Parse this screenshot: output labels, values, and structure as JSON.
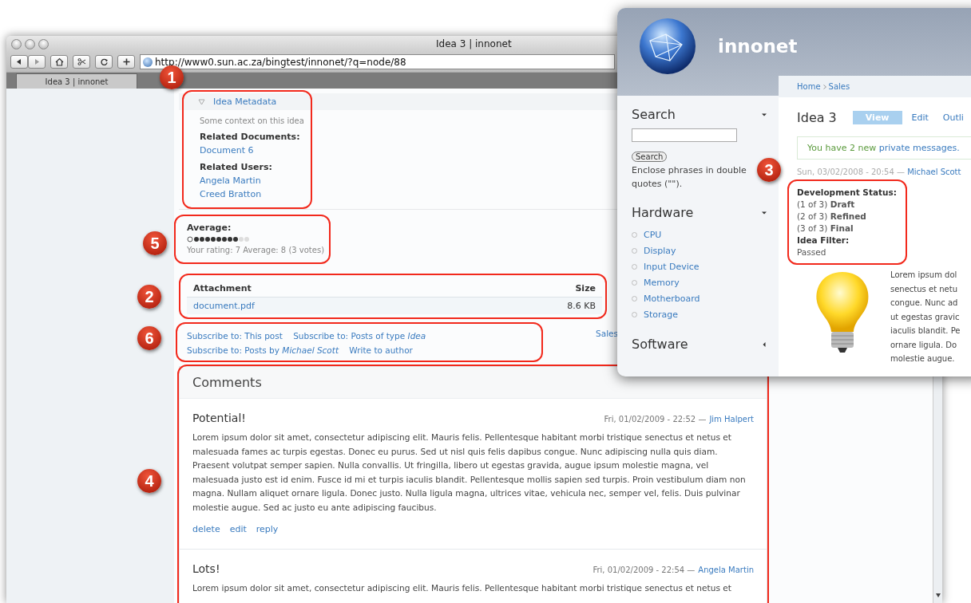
{
  "browser": {
    "title": "Idea 3 | innonet",
    "url": "http://www0.sun.ac.za/bingtest/innonet/?q=node/88",
    "tabs": [
      {
        "label": "Idea 3 | innonet",
        "selected": true
      }
    ]
  },
  "metadata": {
    "title": "Idea Metadata",
    "expanded": true,
    "context": "Some context on this idea",
    "groups": [
      {
        "label": "Related Documents:",
        "links": [
          "Document 6"
        ]
      },
      {
        "label": "Related Users:",
        "links": [
          "Angela Martin",
          "Creed Bratton"
        ]
      }
    ]
  },
  "rating": {
    "label": "Average:",
    "stars": 8,
    "reading": "Your rating: 7 Average: 8 (3 votes)"
  },
  "attachments": {
    "columns": [
      "Attachment",
      "Size"
    ],
    "rows": [
      {
        "file": "document.pdf",
        "size": "8.6 KB"
      }
    ]
  },
  "links": [
    "Subscribe to: This post",
    "Subscribe to: Posts of type *Idea*",
    "Subscribe to: Posts by *Michael Scott*",
    "Write to author"
  ],
  "tags": [
    "Sales"
  ],
  "comments": {
    "title": "Comments",
    "items": [
      {
        "title": "Potential!",
        "meta": "Fri, 01/02/2009 - 22:52 —",
        "author": "Jim Halpert",
        "body": "Lorem ipsum dolor sit amet, consectetur adipiscing elit. Mauris felis. Pellentesque habitant morbi tristique senectus et netus et malesuada fames ac turpis egestas. Donec eu purus. Sed ut nisl quis felis dapibus congue. Nunc adipiscing nulla quis diam. Praesent volutpat semper sapien. Nulla convallis. Ut fringilla, libero ut egestas gravida, augue ipsum molestie magna, vel malesuada justo est id enim. Fusce id mi et turpis iaculis blandit. Pellentesque mollis sapien sed turpis. Proin vestibulum diam non magna. Nullam aliquet ornare ligula. Donec justo. Nulla ligula magna, ultrices vitae, vehicula nec, semper vel, felis. Duis pulvinar molestie augue. Sed ac justo eu ante adipiscing faucibus.",
        "actions": [
          "delete",
          "edit",
          "reply"
        ]
      },
      {
        "title": "Lots!",
        "meta": "Fri, 01/02/2009 - 22:54 —",
        "author": "Angela Martin",
        "body": "Lorem ipsum dolor sit amet, consectetur adipiscing elit. Mauris felis. Pellentesque habitant morbi tristique senectus et netus et"
      }
    ]
  },
  "site": {
    "name": "innonet",
    "sidebar": [
      {
        "kind": "search",
        "title": "Search",
        "expanded": true,
        "button": "Search",
        "hint": "Enclose phrases in double quotes (\"\")."
      },
      {
        "kind": "menu",
        "title": "Hardware",
        "expanded": true,
        "items": [
          "CPU",
          "Display",
          "Input Device",
          "Memory",
          "Motherboard",
          "Storage"
        ]
      },
      {
        "kind": "menu",
        "title": "Software",
        "expanded": false
      }
    ],
    "breadcrumb": [
      "Home",
      "Sales"
    ],
    "page_title": "Idea 3",
    "tabs": [
      {
        "label": "View",
        "selected": true
      },
      {
        "label": "Edit",
        "selected": false
      },
      {
        "label": "Outli",
        "selected": false
      }
    ],
    "message": "You have 2 new",
    "message_link": "private messages.",
    "submitted": "Sun, 03/02/2008 - 20:54 —",
    "author": "Michael Scott",
    "fields": [
      {
        "label": "Development Status:",
        "values": [
          "(1 of 3) **Draft**",
          "(2 of 3) **Refined**",
          "(3 of 3) **Final**"
        ]
      },
      {
        "label": "Idea Filter:",
        "values": [
          "Passed"
        ]
      }
    ],
    "body_lines": [
      "Lorem ipsum dol",
      "senectus et netu",
      "congue. Nunc ad",
      "ut egestas gravic",
      "iaculis blandit. Pe",
      "ornare ligula. Do",
      "molestie augue."
    ]
  },
  "callouts": [
    "1",
    "2",
    "3",
    "4",
    "5",
    "6"
  ]
}
